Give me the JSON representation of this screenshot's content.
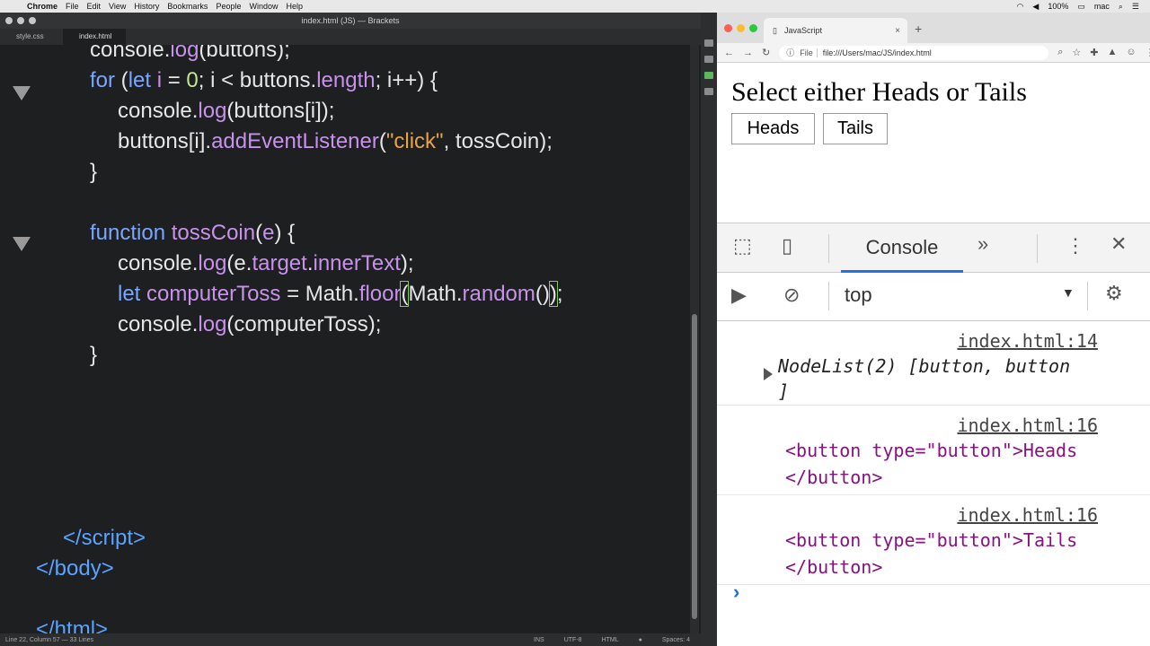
{
  "menubar": {
    "app": "Chrome",
    "items": [
      "File",
      "Edit",
      "View",
      "History",
      "Bookmarks",
      "People",
      "Window",
      "Help"
    ],
    "battery": "100%",
    "user": "mac"
  },
  "editor": {
    "window_title": "index.html (JS) — Brackets",
    "tabs": [
      "style.css",
      "index.html"
    ],
    "status": {
      "position": "Line 22, Column 57 — 33 Lines",
      "mode": "INS",
      "encoding": "UTF-8",
      "language": "HTML",
      "spaces": "Spaces: 4"
    }
  },
  "browser": {
    "tab_title": "JavaScript",
    "address_label": "File",
    "url": "file:///Users/mac/JS/index.html",
    "page": {
      "heading": "Select either Heads or Tails",
      "buttons": [
        "Heads",
        "Tails"
      ]
    }
  },
  "devtools": {
    "active_tab": "Console",
    "context": "top",
    "messages": [
      {
        "source": "index.html:14",
        "lines": [
          "NodeList(2) [button, button",
          "]"
        ]
      },
      {
        "source": "index.html:16",
        "lines": [
          "<button type=\"button\">Heads",
          "</button>"
        ]
      },
      {
        "source": "index.html:16",
        "lines": [
          "<button type=\"button\">Tails",
          "</button>"
        ]
      }
    ],
    "prompt": "›"
  },
  "colors": {
    "editor_bg": "#1d1f21",
    "keyword": "#7aa6ff",
    "function": "#c792ea",
    "number": "#c3e88d",
    "string": "#e7a447",
    "console_accent": "#1a73e8"
  }
}
